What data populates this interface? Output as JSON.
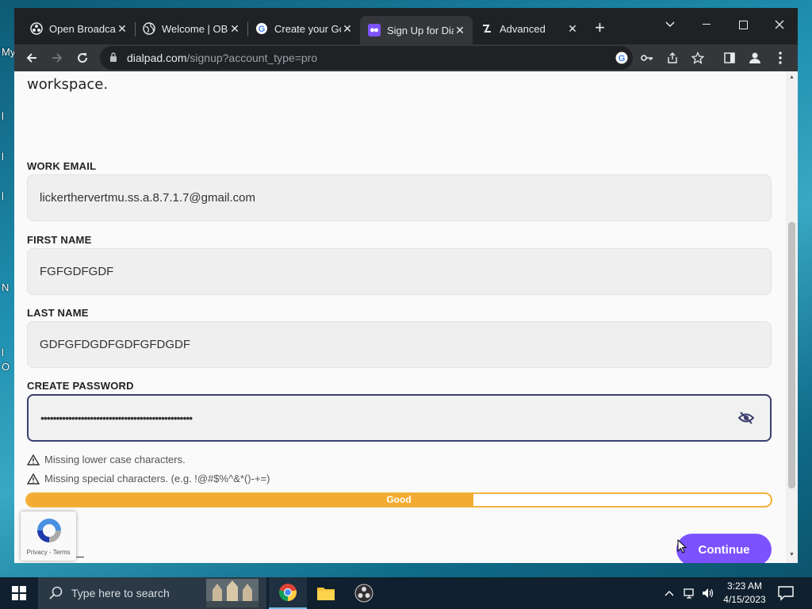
{
  "desktop": {
    "fragments": [
      "My",
      "l",
      "l",
      "l",
      "N",
      "l",
      "O"
    ]
  },
  "browser": {
    "tabs": [
      {
        "title": "Open Broadcaster",
        "icon": "obs-icon",
        "active": false
      },
      {
        "title": "Welcome | OBS",
        "icon": "globe-icon",
        "active": false
      },
      {
        "title": "Create your Google",
        "icon": "google-icon",
        "active": false
      },
      {
        "title": "Sign Up for Dialpad",
        "icon": "dialpad-icon",
        "active": true
      },
      {
        "title": "Advanced",
        "icon": "app-icon",
        "active": false
      }
    ],
    "new_tab_label": "+",
    "address": {
      "host": "dialpad.com",
      "path": "/signup?account_type=pro"
    }
  },
  "page": {
    "heading_fragment": "workspace.",
    "fields": {
      "email": {
        "label": "WORK EMAIL",
        "value": "lickerthervertmu.ss.a.8.7.1.7@gmail.com"
      },
      "first_name": {
        "label": "FIRST NAME",
        "value": "FGFGDFGDF"
      },
      "last_name": {
        "label": "LAST NAME",
        "value": "GDFGFDGDFGDFGFDGDF"
      },
      "password": {
        "label": "CREATE PASSWORD",
        "value": "•••••••••••••••••••••••••••••••••••••••••••••••••"
      }
    },
    "warnings": [
      "Missing lower case characters.",
      "Missing special characters. (e.g. !@#$%^&*()-+=)"
    ],
    "strength": {
      "label": "Good",
      "level": 0.6,
      "color": "#f3ab32"
    },
    "recaptcha": {
      "links": "Privacy - Terms"
    },
    "continue_label": "Continue",
    "accent_color": "#7c52ff"
  },
  "taskbar": {
    "search_placeholder": "Type here to search",
    "time": "3:23 AM",
    "date": "4/15/2023"
  }
}
